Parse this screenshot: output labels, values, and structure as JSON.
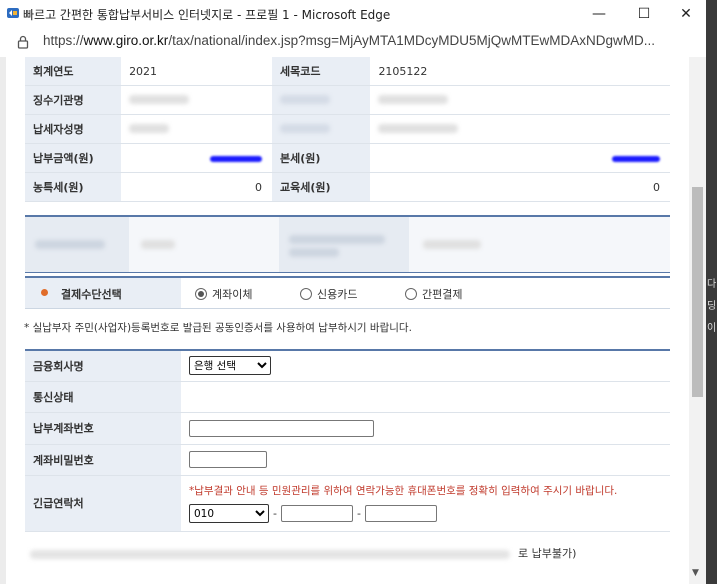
{
  "window": {
    "title": "빠르고 간편한 통합납부서비스 인터넷지로 - 프로필 1 - Microsoft Edge",
    "minimize": "—",
    "maximize": "☐",
    "close": "✕"
  },
  "address": {
    "scheme": "https://",
    "host": "www.giro.or.kr",
    "path": "/tax/national/index.jsp?msg=MjAyMTA1MDcyMDU5MjQwMTEwMDAxNDgwMD..."
  },
  "info_table": {
    "row1": {
      "label1": "회계연도",
      "value1": "2021",
      "label2": "세목코드",
      "value2": "2105122"
    },
    "row2": {
      "label1": "징수기관명",
      "label2": ""
    },
    "row3": {
      "label1": "납세자성명",
      "label2": ""
    },
    "row4": {
      "label1": "납부금액(원)",
      "label2": "본세(원)"
    },
    "row5": {
      "label1": "농특세(원)",
      "value1": "0",
      "label2": "교육세(원)",
      "value2": "0"
    }
  },
  "payment_method": {
    "label": "결제수단선택",
    "options": [
      "계좌이체",
      "신용카드",
      "간편결제"
    ],
    "selected": "계좌이체"
  },
  "notice": "* 실납부자 주민(사업자)등록번호로 발급된 공동인증서를 사용하여 납부하시기 바랍니다.",
  "form": {
    "bank_label": "금융회사명",
    "bank_select": "은행 선택",
    "status_label": "통신상태",
    "account_label": "납부계좌번호",
    "password_label": "계좌비밀번호",
    "contact_label": "긴급연락처",
    "contact_notice": "*납부결과 안내 등 민원관리를 위하여 연락가능한 휴대폰번호를 정확히 입력하여 주시기 바랍니다.",
    "phone_prefix": "010",
    "dash": "-"
  },
  "footer_text": "로 납부불가)",
  "side_labels": [
    "다",
    "딩",
    "이"
  ],
  "colors": {
    "accent": "#5878a8",
    "header_bg": "#e9eef5",
    "warning": "#c0392b",
    "redact": "#1a1aff"
  }
}
